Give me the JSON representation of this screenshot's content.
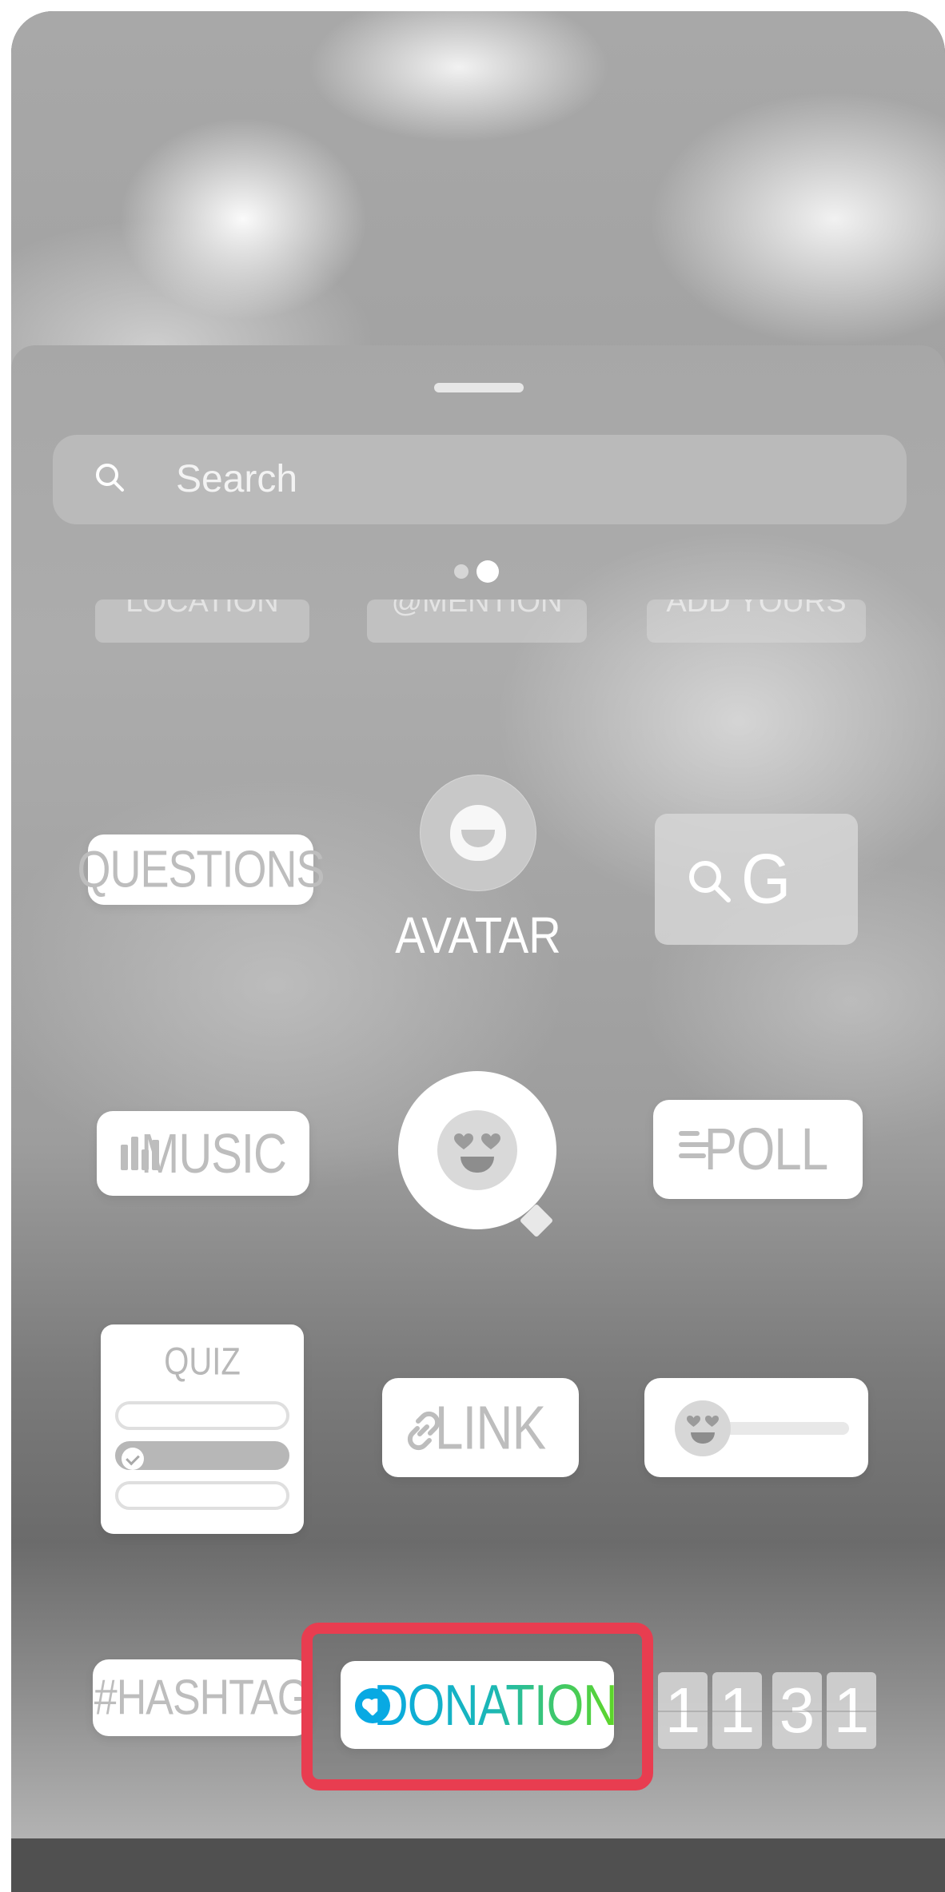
{
  "search": {
    "placeholder": "Search",
    "icon": "search-icon"
  },
  "pagination": {
    "total": 2,
    "active_index": 1
  },
  "cutoff_row": [
    {
      "label": "LOCATION"
    },
    {
      "label": "@MENTION"
    },
    {
      "label": "ADD YOURS"
    }
  ],
  "stickers": {
    "questions": "QUESTIONS",
    "avatar": "AVATAR",
    "gif_letter": "G",
    "music": "MUSIC",
    "poll": "POLL",
    "quiz": "QUIZ",
    "link": "LINK",
    "hashtag": "#HASHTAG",
    "donation": "DONATION",
    "countdown_digits": [
      "1",
      "1",
      "3",
      "1"
    ]
  },
  "colors": {
    "highlight": "#e83d50",
    "donation_icon": "#08a9e3",
    "donation_text_start": "#08a9e3",
    "donation_text_end": "#5ed629"
  }
}
